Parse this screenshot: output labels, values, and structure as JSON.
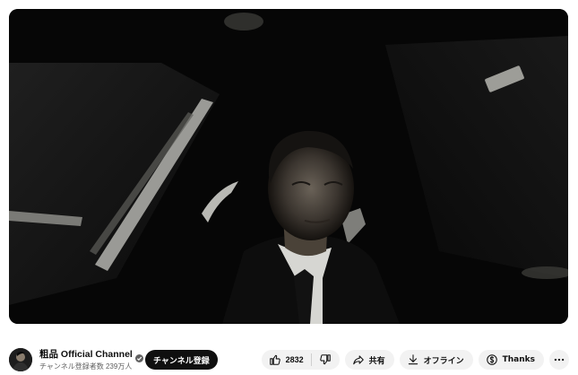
{
  "video": {
    "scene": "dark-car-interior-night"
  },
  "channel": {
    "name": "粗品 Official Channel",
    "subscribers": "チャンネル登録者数 239万人",
    "verified_icon": "verified-check-icon"
  },
  "subscribe": {
    "label": "チャンネル登録"
  },
  "actions": {
    "like_count": "2832",
    "share_label": "共有",
    "offline_label": "オフライン",
    "thanks_label": "Thanks",
    "icons": {
      "like": "thumbs-up-icon",
      "dislike": "thumbs-down-icon",
      "share": "share-arrow-icon",
      "offline": "download-icon",
      "thanks": "thanks-dollar-icon",
      "more": "more-horizontal-icon"
    }
  },
  "colors": {
    "subscribe_bg": "#0f0f0f",
    "pill_bg": "#f2f2f2",
    "player_bg": "#050505"
  }
}
